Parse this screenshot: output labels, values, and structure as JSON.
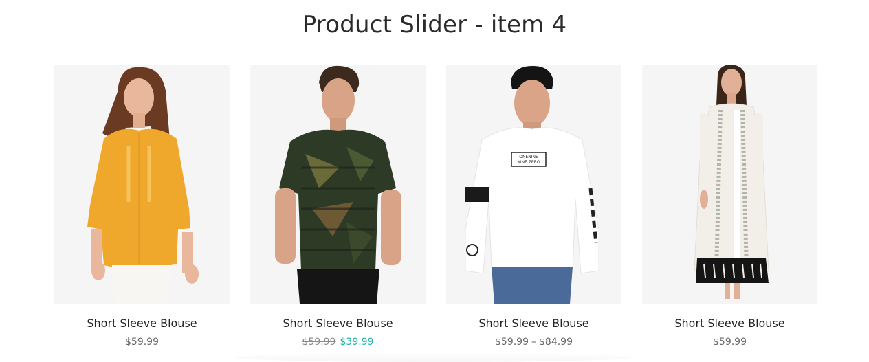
{
  "page": {
    "title": "Product Slider - item 4"
  },
  "products": [
    {
      "name": "Short Sleeve Blouse",
      "price": "$59.99",
      "image_icon": "woman-yellow-blouse-photo"
    },
    {
      "name": "Short Sleeve Blouse",
      "old_price": "$59.99",
      "sale_price": "$39.99",
      "image_icon": "man-camo-tshirt-photo"
    },
    {
      "name": "Short Sleeve Blouse",
      "price_min": "$59.99",
      "price_sep": "–",
      "price_max": "$84.99",
      "image_icon": "man-white-longsleeve-photo"
    },
    {
      "name": "Short Sleeve Blouse",
      "price": "$59.99",
      "image_icon": "woman-white-kurta-photo"
    }
  ],
  "image_text": {
    "tshirt_print": [
      "ONENINE",
      "NINE ZERO"
    ]
  },
  "colors": {
    "sale": "#21b3a4",
    "image_bg": "#f5f5f5"
  }
}
